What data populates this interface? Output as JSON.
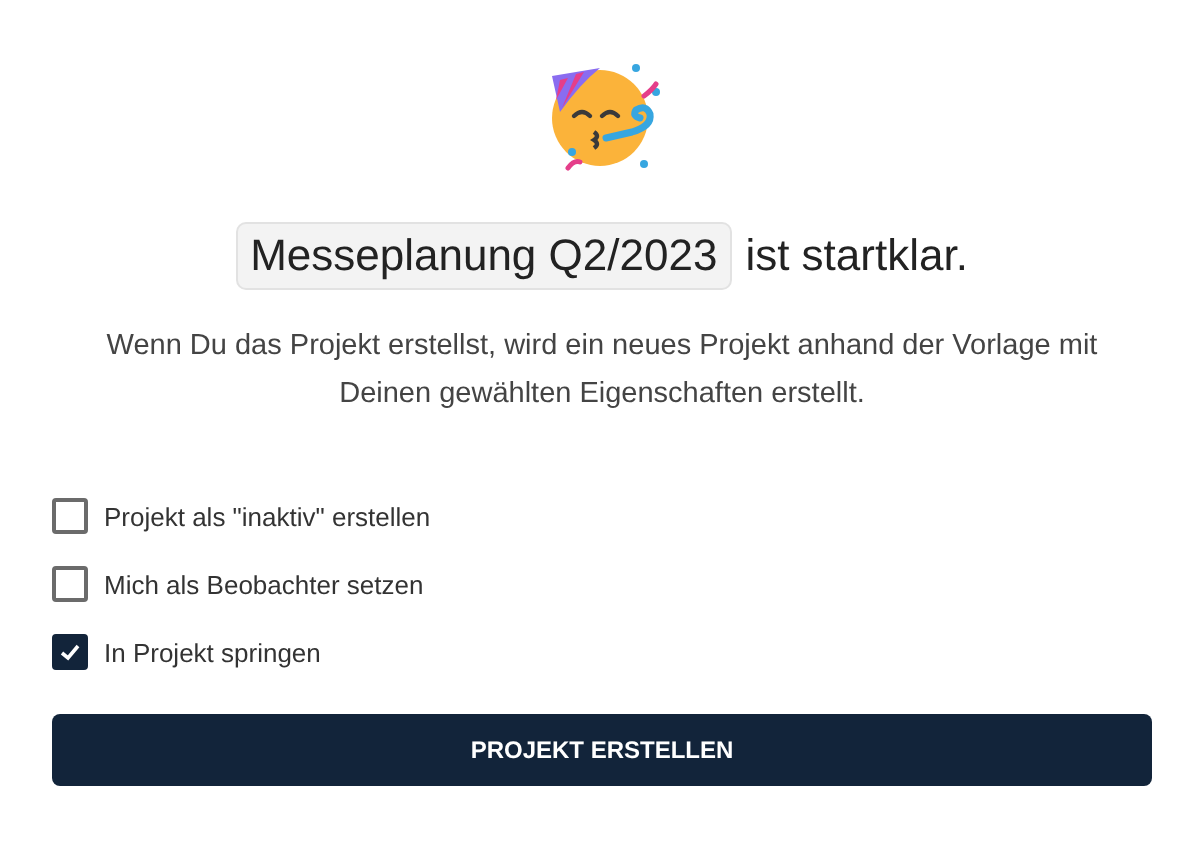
{
  "heading": {
    "project_name": "Messeplanung Q2/2023",
    "suffix": "ist startklar."
  },
  "description": "Wenn Du das Projekt erstellst, wird ein neues Projekt anhand der Vorlage mit Deinen gewählten Eigenschaften erstellt.",
  "options": [
    {
      "label": "Projekt als \"inaktiv\" erstellen",
      "checked": false
    },
    {
      "label": "Mich als Beobachter setzen",
      "checked": false
    },
    {
      "label": "In Projekt springen",
      "checked": true
    }
  ],
  "submit_button": "PROJEKT ERSTELLEN"
}
